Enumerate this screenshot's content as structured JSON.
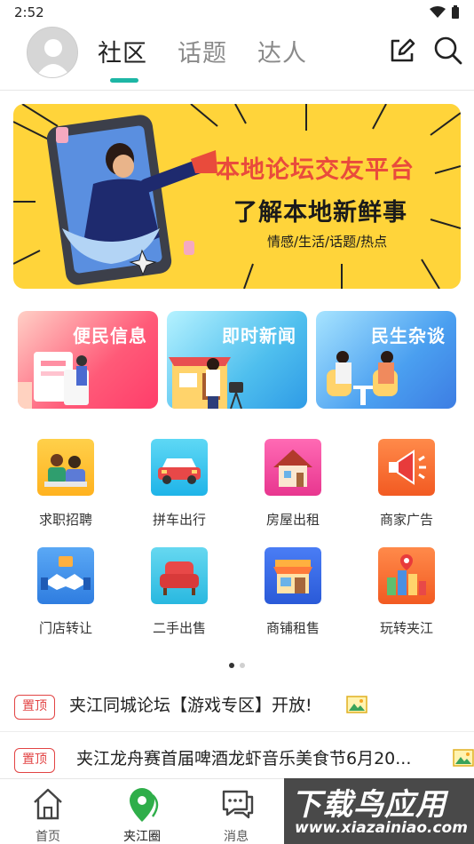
{
  "status": {
    "time": "2:52"
  },
  "header": {
    "tabs": [
      {
        "label": "社区",
        "active": true
      },
      {
        "label": "话题",
        "active": false
      },
      {
        "label": "达人",
        "active": false
      }
    ],
    "accent": "#1db6a5"
  },
  "banner": {
    "title": "本地论坛交友平台",
    "subtitle": "了解本地新鲜事",
    "tags": "情感/生活/话题/热点"
  },
  "cards": [
    {
      "label": "便民信息"
    },
    {
      "label": "即时新闻"
    },
    {
      "label": "民生杂谈"
    }
  ],
  "grid": [
    {
      "label": "求职招聘",
      "icon": "recruit-icon"
    },
    {
      "label": "拼车出行",
      "icon": "car-icon"
    },
    {
      "label": "房屋出租",
      "icon": "house-icon"
    },
    {
      "label": "商家广告",
      "icon": "megaphone-icon"
    },
    {
      "label": "门店转让",
      "icon": "handshake-icon"
    },
    {
      "label": "二手出售",
      "icon": "sofa-icon"
    },
    {
      "label": "商铺租售",
      "icon": "shop-icon"
    },
    {
      "label": "玩转夹江",
      "icon": "city-pin-icon"
    }
  ],
  "posts": [
    {
      "tag": "置顶",
      "title": "夹江同城论坛【游戏专区】开放!"
    },
    {
      "tag": "置顶",
      "title": "夹江龙舟赛首届啤酒龙虾音乐美食节6月20..."
    }
  ],
  "bottomnav": [
    {
      "label": "首页",
      "icon": "home-icon"
    },
    {
      "label": "夹江圈",
      "icon": "location-icon",
      "active": true
    },
    {
      "label": "消息",
      "icon": "message-icon"
    }
  ],
  "watermark": {
    "line1": "下载鸟应用",
    "line2": "www.xiazainiao.com"
  }
}
